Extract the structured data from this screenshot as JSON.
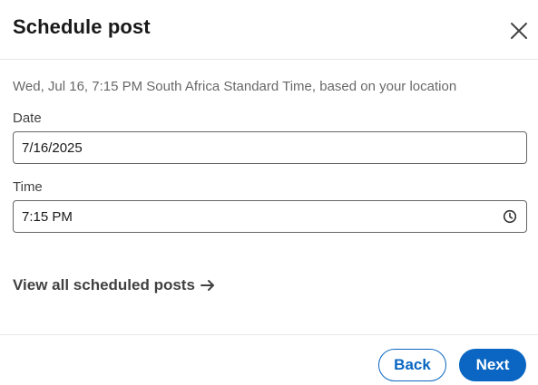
{
  "dialog": {
    "title": "Schedule post",
    "subtitle": "Wed, Jul 16, 7:15 PM South Africa Standard Time, based on your location"
  },
  "date_field": {
    "label": "Date",
    "value": "7/16/2025"
  },
  "time_field": {
    "label": "Time",
    "value": "7:15 PM",
    "icon": "clock-icon"
  },
  "links": {
    "view_scheduled": "View all scheduled posts",
    "arrow_icon": "arrow-right-icon"
  },
  "footer": {
    "back_label": "Back",
    "next_label": "Next"
  },
  "colors": {
    "accent": "#0a66c2",
    "text_primary": "#1a1a1a",
    "text_secondary": "#666666",
    "border": "#666666",
    "divider": "#e8e8e8"
  },
  "icons": {
    "close": "close-icon"
  }
}
